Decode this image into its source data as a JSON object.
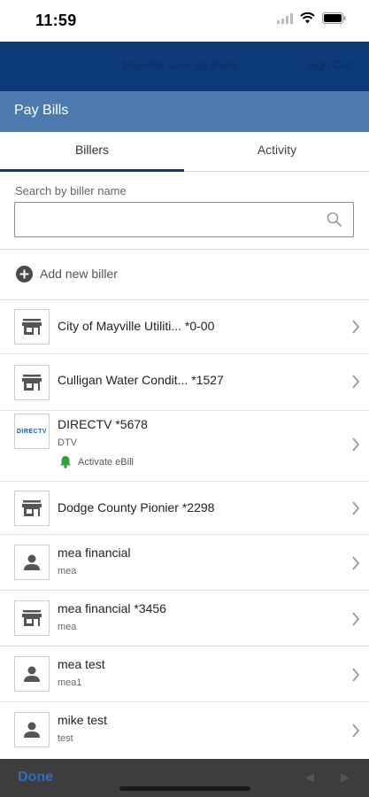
{
  "status_bar": {
    "time": "11:59"
  },
  "header": {
    "bank_name": "Mayville Savings Bank",
    "sign_out_label": "Sign Out"
  },
  "page": {
    "title": "Pay Bills"
  },
  "tabs": [
    {
      "label": "Billers"
    },
    {
      "label": "Activity"
    }
  ],
  "search": {
    "label": "Search by biller name",
    "placeholder": "",
    "value": ""
  },
  "add_biller": {
    "label": "Add new biller"
  },
  "billers": [
    {
      "icon": "store-icon",
      "title": "City of Mayville Utiliti...  *0-00",
      "subtitle": ""
    },
    {
      "icon": "store-icon",
      "title": "Culligan Water Condit...  *1527",
      "subtitle": ""
    },
    {
      "icon": "directv-logo",
      "logo_text": "DIRECTV",
      "title": "DIRECTV *5678",
      "subtitle": "DTV",
      "ebill_label": "Activate eBill"
    },
    {
      "icon": "store-icon",
      "title": "Dodge County Pionier *2298",
      "subtitle": ""
    },
    {
      "icon": "person-icon",
      "title": "mea financial",
      "subtitle": "mea"
    },
    {
      "icon": "store-icon",
      "title": "mea financial *3456",
      "subtitle": "mea"
    },
    {
      "icon": "person-icon",
      "title": "mea test",
      "subtitle": "mea1"
    },
    {
      "icon": "person-icon",
      "title": "mike test",
      "subtitle": "test"
    }
  ],
  "bottom_bar": {
    "done_label": "Done",
    "prev_arrow": "◀",
    "next_arrow": "▶"
  },
  "colors": {
    "header": "#0d3a78",
    "title_bar": "#4d7aad",
    "ebill_bell": "#2fa33a",
    "done": "#2e6ec2"
  }
}
